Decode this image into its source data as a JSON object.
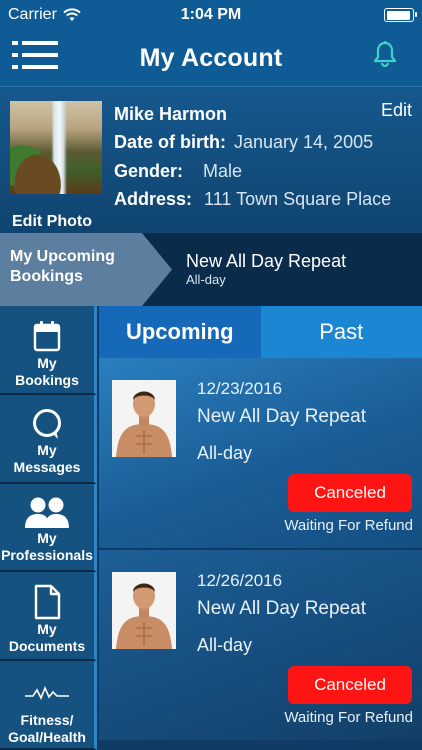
{
  "status_bar": {
    "carrier": "Carrier",
    "time": "1:04 PM",
    "battery_level": 0.95
  },
  "header": {
    "title": "My Account",
    "menu_icon": "hamburger-menu-icon",
    "notification_icon": "bell-icon"
  },
  "profile": {
    "name": "Mike Harmon",
    "edit_label": "Edit",
    "edit_photo_label": "Edit Photo",
    "dob_label": "Date of birth:",
    "dob_value": "January 14, 2005",
    "gender_label": "Gender:",
    "gender_value": "Male",
    "address_label": "Address:",
    "address_value": "111 Town Square Place"
  },
  "upcoming_strip": {
    "label_line1": "My Upcoming",
    "label_line2": "Bookings",
    "title": "New All Day Repeat",
    "subtitle": "All-day"
  },
  "side_nav": [
    {
      "line1": "My",
      "line2": "Bookings",
      "icon": "calendar-icon"
    },
    {
      "line1": "My",
      "line2": "Messages",
      "icon": "chat-bubble-icon"
    },
    {
      "line1": "My",
      "line2": "Professionals",
      "icon": "people-icon"
    },
    {
      "line1": "My",
      "line2": "Documents",
      "icon": "document-icon"
    },
    {
      "line1": "Fitness/",
      "line2": "Goal/Health",
      "icon": "heartbeat-icon"
    }
  ],
  "tabs": {
    "upcoming": "Upcoming",
    "past": "Past",
    "active": "upcoming"
  },
  "bookings": [
    {
      "date": "12/23/2016",
      "title": "New All Day Repeat",
      "time": "All-day",
      "status": "Canceled",
      "note": "Waiting For Refund"
    },
    {
      "date": "12/26/2016",
      "title": "New All Day Repeat",
      "time": "All-day",
      "status": "Canceled",
      "note": "Waiting For Refund"
    }
  ],
  "colors": {
    "header": "#0f5b95",
    "active_tab": "#1668b8",
    "inactive_tab": "#1b86d3",
    "cancel": "#ff1414"
  }
}
